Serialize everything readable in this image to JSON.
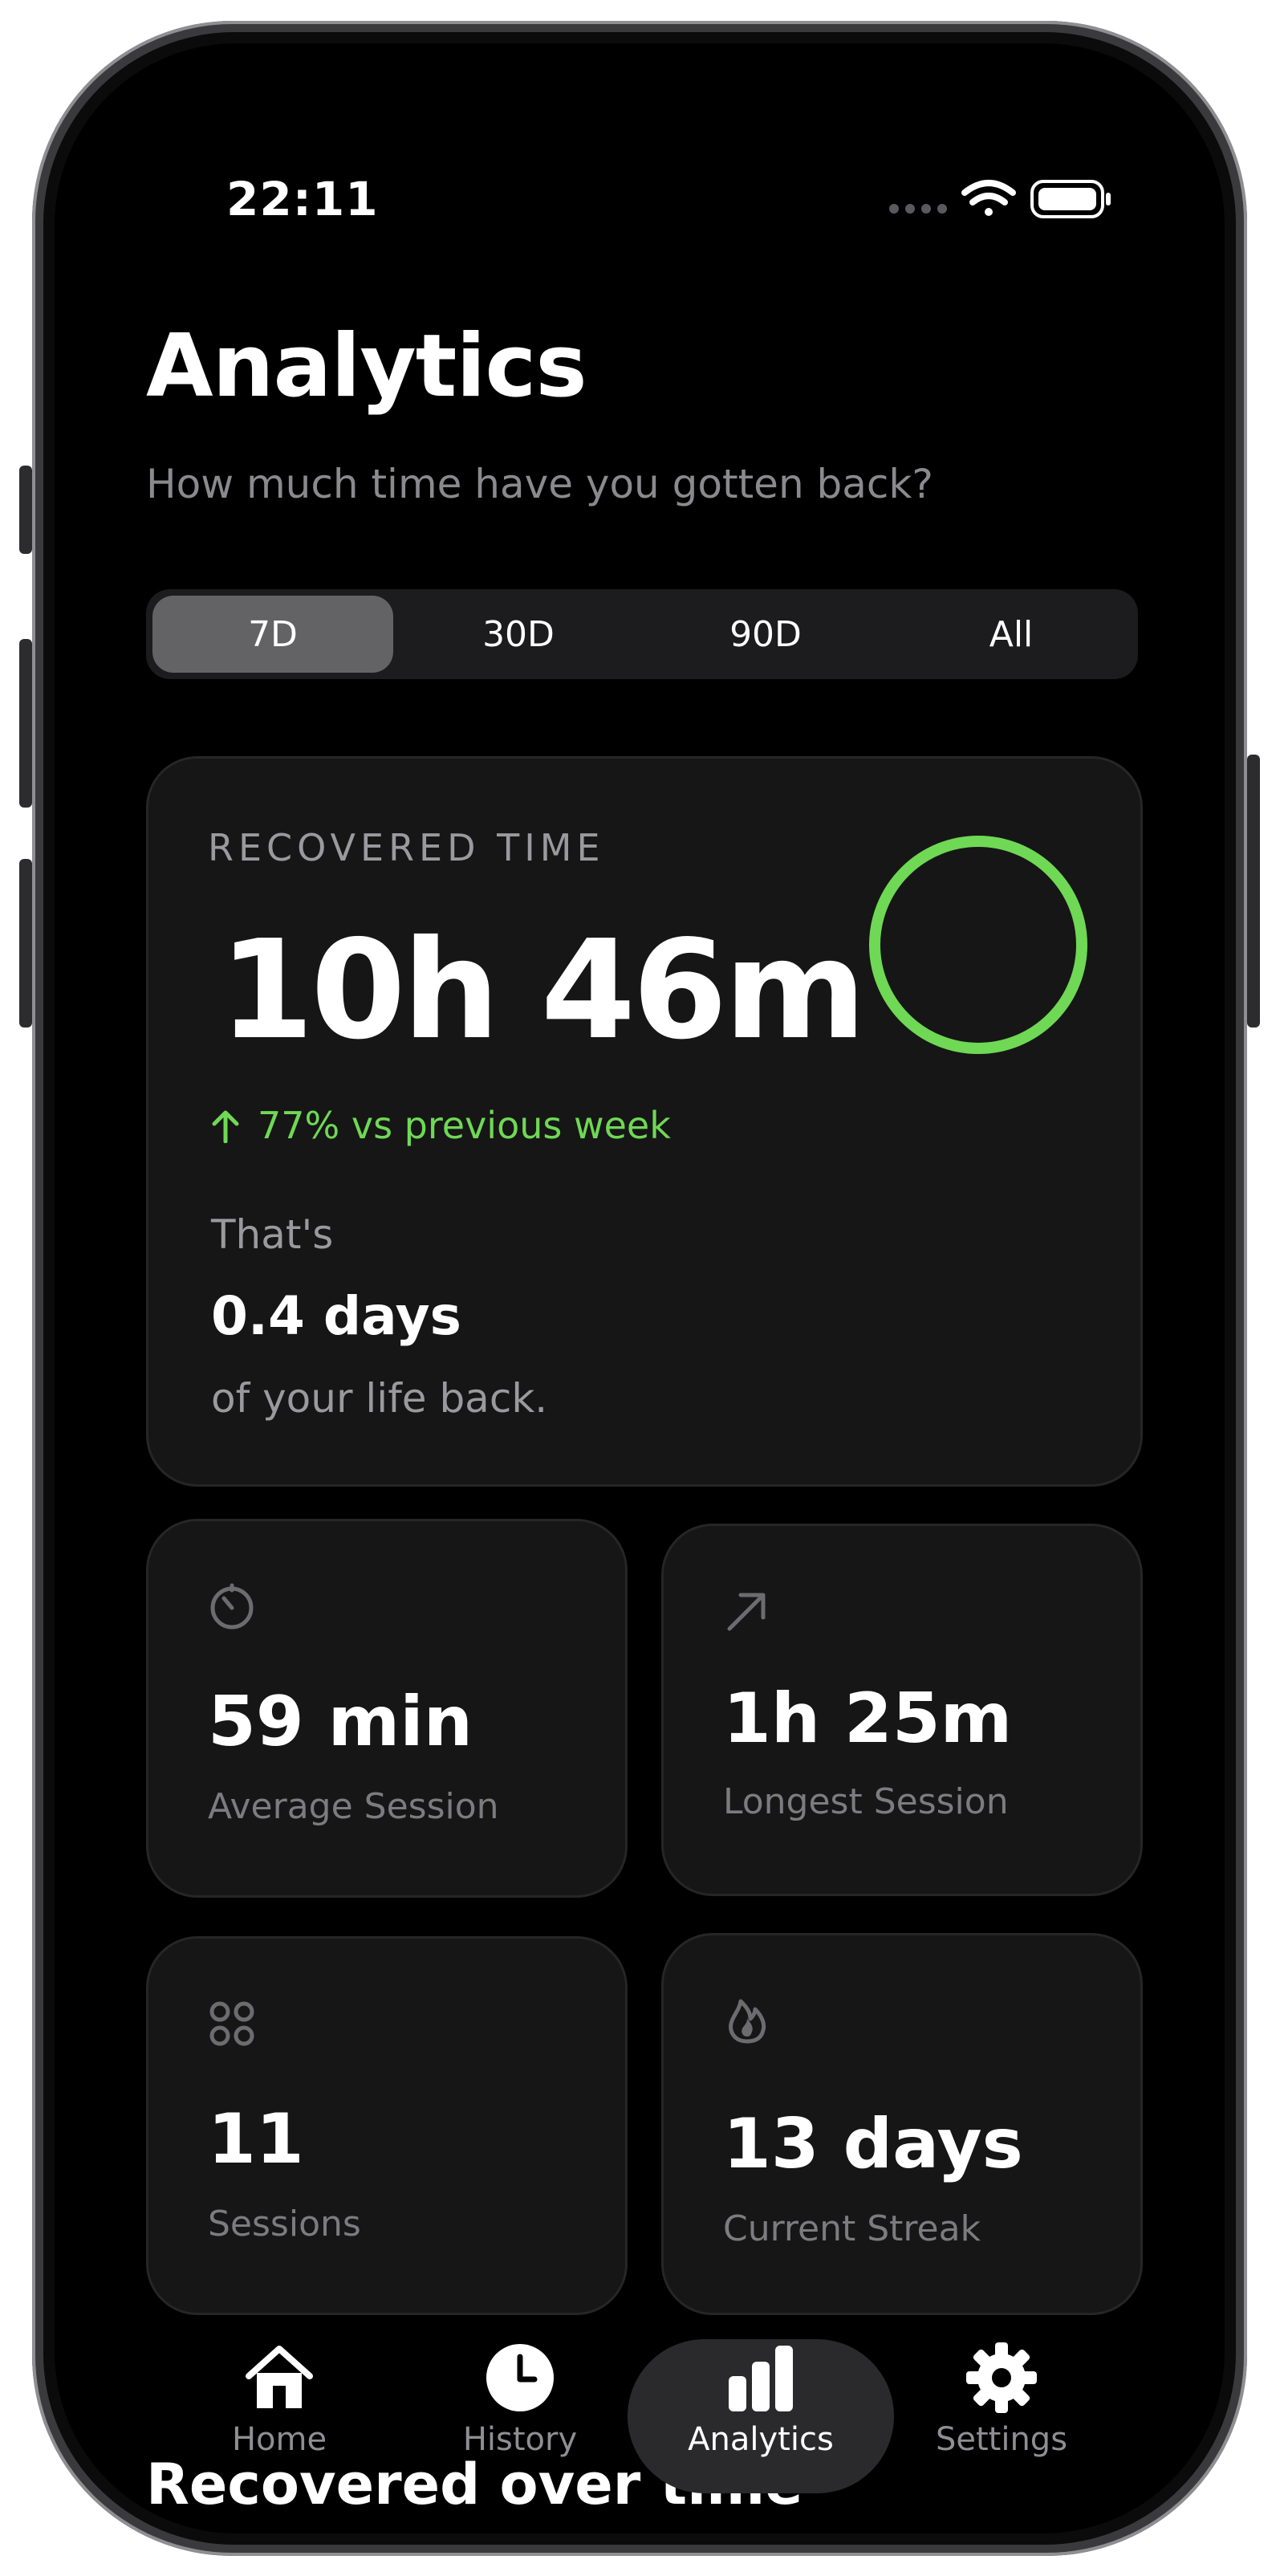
{
  "status_bar": {
    "time": "22:11",
    "icons": [
      "cellular-dots-icon",
      "wifi-icon",
      "battery-icon"
    ]
  },
  "header": {
    "title": "Analytics",
    "subtitle": "How much time have you gotten back?"
  },
  "range_selector": {
    "options": [
      "7D",
      "30D",
      "90D",
      "All"
    ],
    "selected": "7D"
  },
  "recovered_card": {
    "label": "RECOVERED TIME",
    "value": "10h 46m",
    "delta": "77% vs previous week",
    "delta_icon": "arrow-up-icon",
    "thats": "That's",
    "days": "0.4 days",
    "life_back": "of your life back.",
    "ring_color": "#6fd855"
  },
  "stats": [
    {
      "icon": "timer-icon",
      "value": "59 min",
      "label": "Average Session"
    },
    {
      "icon": "arrow-up-right-icon",
      "value": "1h 25m",
      "label": "Longest Session"
    },
    {
      "icon": "grid-dots-icon",
      "value": "11",
      "label": "Sessions"
    },
    {
      "icon": "flame-icon",
      "value": "13 days",
      "label": "Current Streak"
    }
  ],
  "section": {
    "title": "Recovered over time"
  },
  "tab_bar": {
    "items": [
      {
        "label": "Home",
        "icon": "house-icon"
      },
      {
        "label": "History",
        "icon": "clock-icon"
      },
      {
        "label": "Analytics",
        "icon": "bar-chart-icon"
      },
      {
        "label": "Settings",
        "icon": "gear-icon"
      }
    ],
    "active": "Analytics"
  },
  "colors": {
    "accent_green": "#6fd855",
    "background": "#000000",
    "card": "#161616",
    "muted_text": "#8a8a8e"
  }
}
